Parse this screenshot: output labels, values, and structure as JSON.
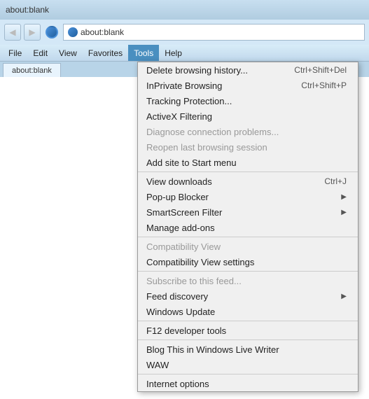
{
  "browser": {
    "address": "about:blank",
    "title": "about:blank"
  },
  "menubar": {
    "items": [
      {
        "label": "File",
        "active": false
      },
      {
        "label": "Edit",
        "active": false
      },
      {
        "label": "View",
        "active": false
      },
      {
        "label": "Favorites",
        "active": false
      },
      {
        "label": "Tools",
        "active": true
      },
      {
        "label": "Help",
        "active": false
      }
    ]
  },
  "toolsMenu": {
    "entries": [
      {
        "id": "delete-history",
        "label": "Delete browsing history...",
        "shortcut": "Ctrl+Shift+Del",
        "disabled": false,
        "arrow": false,
        "separator_after": false
      },
      {
        "id": "inprivate",
        "label": "InPrivate Browsing",
        "shortcut": "Ctrl+Shift+P",
        "disabled": false,
        "arrow": false,
        "separator_after": false
      },
      {
        "id": "tracking",
        "label": "Tracking Protection...",
        "shortcut": "",
        "disabled": false,
        "arrow": false,
        "separator_after": false
      },
      {
        "id": "activex",
        "label": "ActiveX Filtering",
        "shortcut": "",
        "disabled": false,
        "arrow": false,
        "separator_after": false
      },
      {
        "id": "diagnose",
        "label": "Diagnose connection problems...",
        "shortcut": "",
        "disabled": true,
        "arrow": false,
        "separator_after": false
      },
      {
        "id": "reopen",
        "label": "Reopen last browsing session",
        "shortcut": "",
        "disabled": true,
        "arrow": false,
        "separator_after": false
      },
      {
        "id": "add-site",
        "label": "Add site to Start menu",
        "shortcut": "",
        "disabled": false,
        "arrow": false,
        "separator_after": true
      },
      {
        "id": "view-downloads",
        "label": "View downloads",
        "shortcut": "Ctrl+J",
        "disabled": false,
        "arrow": false,
        "separator_after": false
      },
      {
        "id": "popup-blocker",
        "label": "Pop-up Blocker",
        "shortcut": "",
        "disabled": false,
        "arrow": true,
        "separator_after": false
      },
      {
        "id": "smartscreen",
        "label": "SmartScreen Filter",
        "shortcut": "",
        "disabled": false,
        "arrow": true,
        "separator_after": false
      },
      {
        "id": "manage-addons",
        "label": "Manage add-ons",
        "shortcut": "",
        "disabled": false,
        "arrow": false,
        "separator_after": true
      },
      {
        "id": "compat-view",
        "label": "Compatibility View",
        "shortcut": "",
        "disabled": true,
        "arrow": false,
        "separator_after": false
      },
      {
        "id": "compat-view-settings",
        "label": "Compatibility View settings",
        "shortcut": "",
        "disabled": false,
        "arrow": false,
        "separator_after": true
      },
      {
        "id": "subscribe-feed",
        "label": "Subscribe to this feed...",
        "shortcut": "",
        "disabled": true,
        "arrow": false,
        "separator_after": false
      },
      {
        "id": "feed-discovery",
        "label": "Feed discovery",
        "shortcut": "",
        "disabled": false,
        "arrow": true,
        "separator_after": false
      },
      {
        "id": "windows-update",
        "label": "Windows Update",
        "shortcut": "",
        "disabled": false,
        "arrow": false,
        "separator_after": true
      },
      {
        "id": "f12-dev",
        "label": "F12 developer tools",
        "shortcut": "",
        "disabled": false,
        "arrow": false,
        "separator_after": true
      },
      {
        "id": "blog-live-writer",
        "label": "Blog This in Windows Live Writer",
        "shortcut": "",
        "disabled": false,
        "arrow": false,
        "separator_after": false
      },
      {
        "id": "waw",
        "label": "WAW",
        "shortcut": "",
        "disabled": false,
        "arrow": false,
        "separator_after": true
      },
      {
        "id": "internet-options",
        "label": "Internet options",
        "shortcut": "",
        "disabled": false,
        "arrow": false,
        "separator_after": false
      }
    ]
  }
}
